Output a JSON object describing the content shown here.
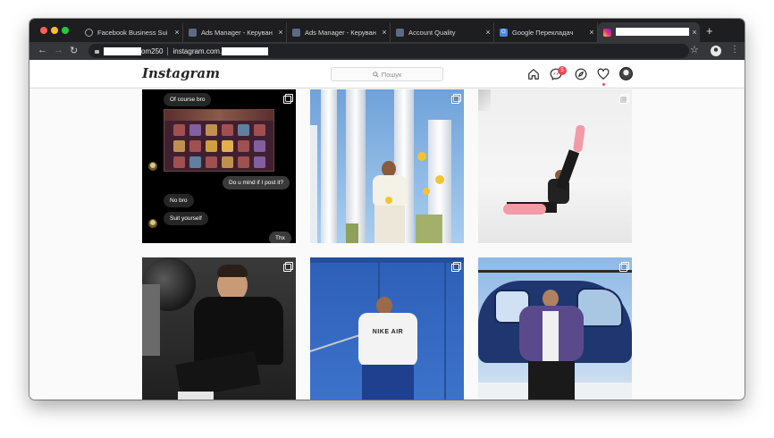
{
  "browser": {
    "tabs": [
      {
        "title": "Facebook Business Sui",
        "close": "×"
      },
      {
        "title": "Ads Manager - Керуван",
        "close": "×"
      },
      {
        "title": "Ads Manager - Керуван",
        "close": "×"
      },
      {
        "title": "Account Quality",
        "close": "×"
      },
      {
        "title": "Google Перекладач",
        "close": "×"
      },
      {
        "title": "",
        "close": "×"
      }
    ],
    "new_tab": "+",
    "url_suffix": "om250",
    "url_domain": "instagram.com"
  },
  "instagram": {
    "logo": "Instagram",
    "search_placeholder": "Пошук",
    "notification_count": "5",
    "icons": [
      "home-icon",
      "direct-messages-icon",
      "explore-icon",
      "activity-heart-icon",
      "profile-avatar"
    ]
  },
  "posts": [
    {
      "type": "chat-screenshot",
      "messages": [
        {
          "text": "Of course bro",
          "from": "them"
        },
        {
          "text": "Do u mind if I post it?",
          "from": "me"
        },
        {
          "text": "No bro",
          "from": "them"
        },
        {
          "text": "Suit yourself",
          "from": "them"
        },
        {
          "text": "Thx",
          "from": "me"
        }
      ]
    },
    {
      "type": "photo",
      "scene": "man posing among white columns with yellow flowers"
    },
    {
      "type": "photo",
      "scene": "man sitting against white wall raising leg"
    },
    {
      "type": "photo",
      "scene": "man in black inside car"
    },
    {
      "type": "photo",
      "scene": "man in Nike Air sweatshirt against blue wall",
      "shirt_text": "NIKE AIR"
    },
    {
      "type": "photo",
      "scene": "man in purple puffer jacket in front of helicopter"
    }
  ],
  "colors": {
    "chrome_dark": "#1e1e20",
    "chrome_toolbar": "#35363a",
    "ig_badge": "#ed4956",
    "ig_border": "#dbdbdb"
  }
}
